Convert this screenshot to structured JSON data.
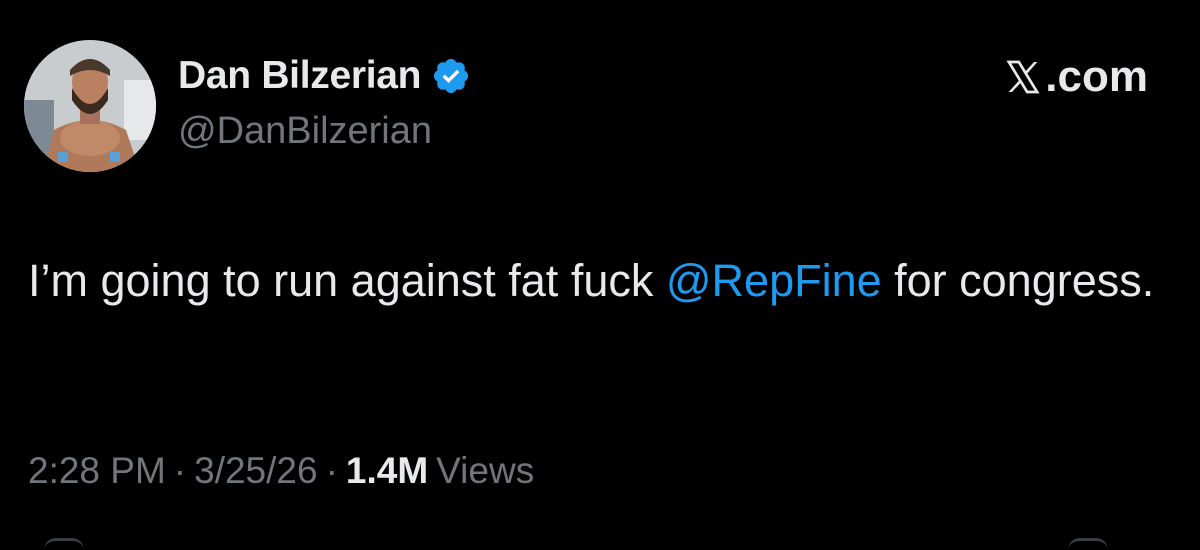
{
  "author": {
    "display_name": "Dan Bilzerian",
    "handle": "@DanBilzerian",
    "verified": true,
    "avatar_icon": "profile-photo"
  },
  "brand": {
    "logo_icon": "x-logo-icon",
    "suffix": ".com"
  },
  "tweet": {
    "text_before": "I’m going to run against fat fuck ",
    "mention": "@RepFine",
    "text_after": " for congress."
  },
  "meta": {
    "time": "2:28 PM",
    "separator": "·",
    "date": "3/25/26",
    "views_count": "1.4M",
    "views_label": "Views"
  },
  "colors": {
    "background": "#000000",
    "primary_text": "#e7e9ea",
    "secondary_text": "#71767b",
    "accent": "#1d9bf0"
  }
}
